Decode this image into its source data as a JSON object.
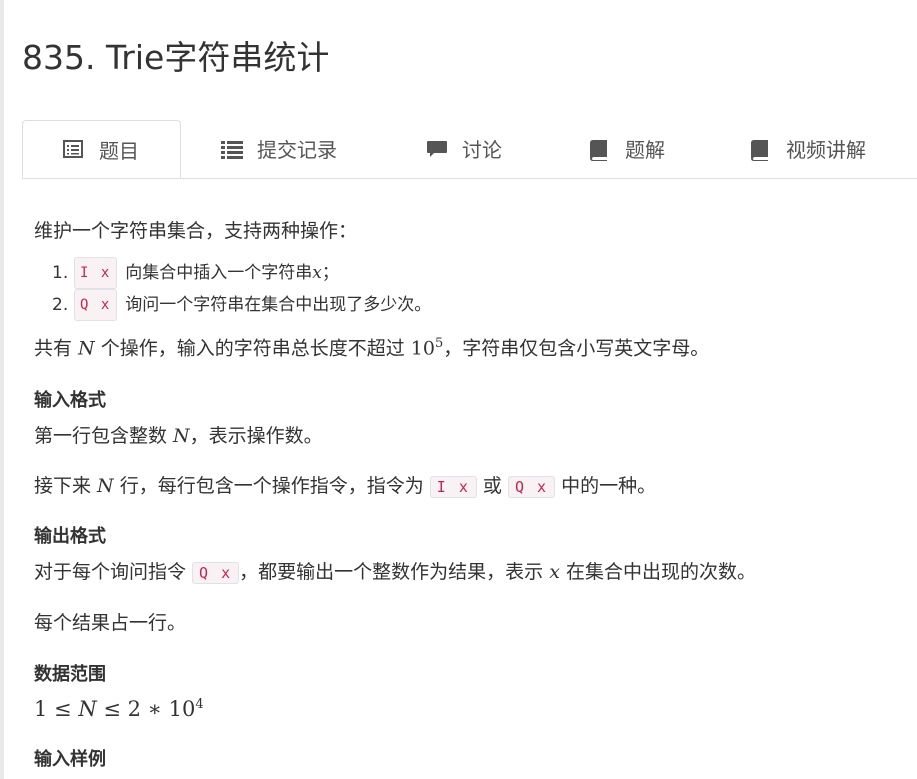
{
  "problem": {
    "title": "835. Trie字符串统计"
  },
  "tabs": [
    {
      "label": "题目",
      "icon": "document-list-icon"
    },
    {
      "label": "提交记录",
      "icon": "list-icon"
    },
    {
      "label": "讨论",
      "icon": "speech-bubble-icon"
    },
    {
      "label": "题解",
      "icon": "book-icon"
    },
    {
      "label": "视频讲解",
      "icon": "book-icon"
    }
  ],
  "description": {
    "intro": "维护一个字符串集合，支持两种操作：",
    "operations": [
      {
        "num": "1.",
        "code": "I x",
        "text_before": "向集合中插入一个字符串 ",
        "var": "x",
        "text_after": "；"
      },
      {
        "num": "2.",
        "code": "Q x",
        "text": "询问一个字符串在集合中出现了多少次。"
      }
    ],
    "constraint": {
      "prefix": "共有 ",
      "var": "N",
      "middle": " 个操作，输入的字符串总长度不超过 ",
      "base": "10",
      "exp": "5",
      "suffix": "，字符串仅包含小写英文字母。"
    }
  },
  "input_format": {
    "heading": "输入格式",
    "line1_prefix": "第一行包含整数 ",
    "line1_var": "N",
    "line1_suffix": "，表示操作数。",
    "line2_prefix": "接下来 ",
    "line2_var": "N",
    "line2_middle": " 行，每行包含一个操作指令，指令为 ",
    "line2_code1": "I x",
    "line2_or": " 或 ",
    "line2_code2": "Q x",
    "line2_suffix": " 中的一种。"
  },
  "output_format": {
    "heading": "输出格式",
    "line1_prefix": "对于每个询问指令 ",
    "line1_code": "Q x",
    "line1_middle": "，都要输出一个整数作为结果，表示 ",
    "line1_var": "x",
    "line1_suffix": " 在集合中出现的次数。",
    "line2": "每个结果占一行。"
  },
  "data_range": {
    "heading": "数据范围",
    "expr_left": "1 ≤ ",
    "expr_var": "N",
    "expr_right": " ≤ 2 ∗ 10",
    "exp": "4"
  },
  "next_heading": "输入样例"
}
